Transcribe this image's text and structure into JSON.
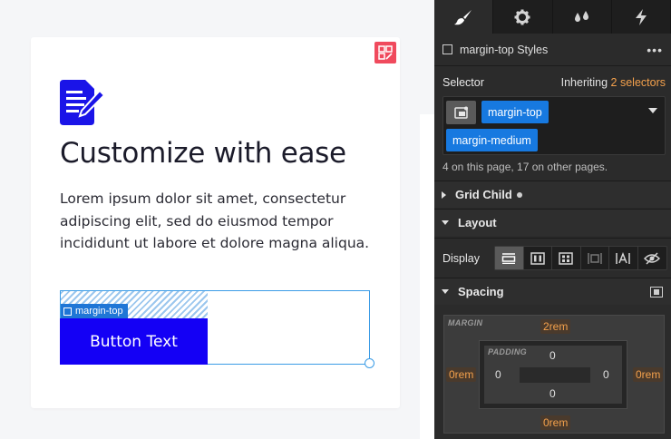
{
  "canvas": {
    "heading": "Customize with ease",
    "paragraph": "Lorem ipsum dolor sit amet, consectetur adipiscing elit, sed do eiusmod tempor incididunt ut labore et dolore magna aliqua.",
    "selection_label": "margin-top",
    "button_text": "Button Text",
    "colors": {
      "button": "#1400f5",
      "selection": "#3b9ce6",
      "badge": "#f04a5d"
    }
  },
  "panel": {
    "tabs": [
      {
        "icon": "paintbrush-icon",
        "active": true
      },
      {
        "icon": "gear-icon",
        "active": false
      },
      {
        "icon": "drops-icon",
        "active": false
      },
      {
        "icon": "lightning-icon",
        "active": false
      }
    ],
    "styles_title": "margin-top Styles",
    "more": "•••",
    "selector_label": "Selector",
    "inheriting_prefix": "Inheriting",
    "inheriting_count": "2 selectors",
    "tags": [
      "margin-top",
      "margin-medium"
    ],
    "pages_note": "4 on this page, 17 on other pages.",
    "sections": {
      "grid_child": "Grid Child",
      "layout": "Layout",
      "spacing": "Spacing"
    },
    "display_label": "Display",
    "display_modes": [
      "block",
      "flex",
      "grid",
      "inline-block",
      "inline",
      "none"
    ],
    "spacing": {
      "margin_label": "MARGIN",
      "padding_label": "PADDING",
      "margin": {
        "top": "2rem",
        "right": "0rem",
        "bottom": "0rem",
        "left": "0rem"
      },
      "padding": {
        "top": "0",
        "right": "0",
        "bottom": "0",
        "left": "0"
      }
    },
    "colors": {
      "accent": "#1779e0",
      "orange": "#f4a14c"
    }
  }
}
